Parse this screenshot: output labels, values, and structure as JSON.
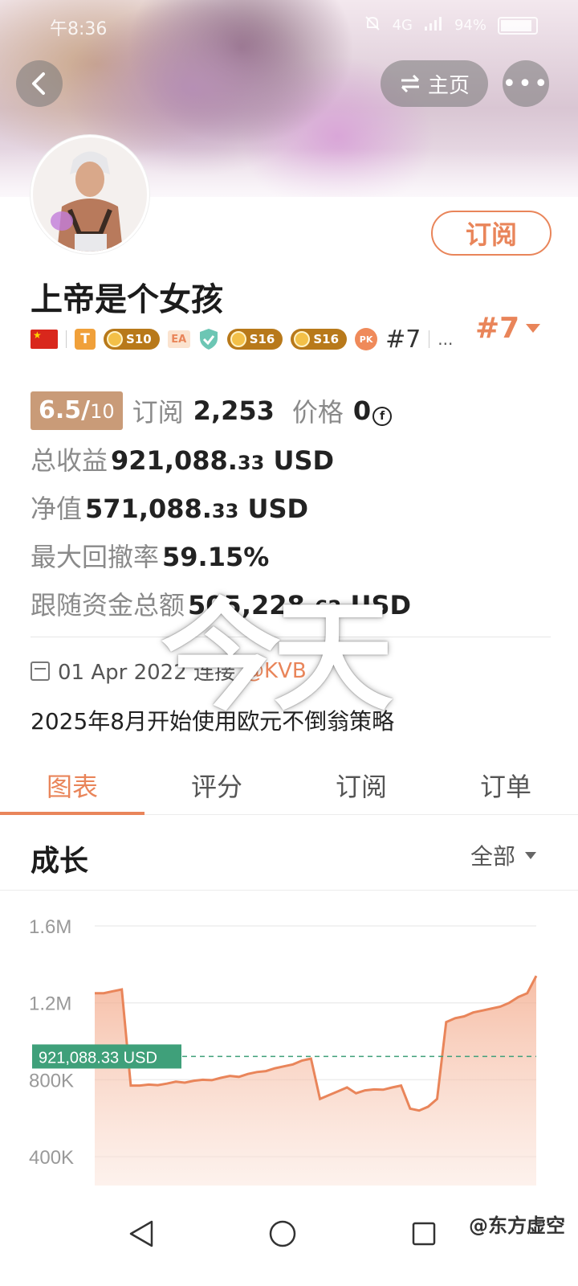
{
  "status_bar": {
    "time": "午8:36",
    "network": "4G",
    "battery": "94%"
  },
  "header": {
    "home_label": "主页"
  },
  "profile": {
    "name": "上帝是个女孩",
    "subscribe_label": "订阅",
    "rank_small": "#7",
    "rank_big": "#7",
    "badges": {
      "t": "T",
      "s10": "S10",
      "ea": "EA",
      "s16a": "S16",
      "s16b": "S16",
      "pk": "PK",
      "more": "..."
    }
  },
  "stats": {
    "score_main": "6.5/",
    "score_total": "10",
    "subs_label": "订阅",
    "subs_value": "2,253",
    "price_label": "价格",
    "price_value": "0",
    "price_coin": "f",
    "total_income_label": "总收益",
    "total_income_main": "921,088.",
    "total_income_cents": "33",
    "total_income_unit": "USD",
    "net_label": "净值",
    "net_main": "571,088.",
    "net_cents": "33",
    "net_unit": "USD",
    "drawdown_label": "最大回撤率",
    "drawdown_value": "59.15%",
    "follow_label": "跟随资金总额",
    "follow_main": "505,228.",
    "follow_cents": "62",
    "follow_unit": "USD"
  },
  "meta": {
    "date": "01 Apr 2022 连接",
    "mention": "@KVB",
    "description": "2025年8月开始使用欧元不倒翁策略"
  },
  "watermark": "今天",
  "tabs": [
    {
      "label": "图表"
    },
    {
      "label": "评分"
    },
    {
      "label": "订阅"
    },
    {
      "label": "订单"
    }
  ],
  "section": {
    "title": "成长",
    "filter": "全部"
  },
  "chart_data": {
    "type": "area",
    "y_ticks": [
      "1.6M",
      "1.2M",
      "800K",
      "400K"
    ],
    "ylim": [
      250000,
      1600000
    ],
    "reference_label": "921,088.33 USD",
    "reference_value": 921088.33,
    "series": [
      {
        "values": [
          1250000,
          1250000,
          1260000,
          1270000,
          770000,
          770000,
          775000,
          772000,
          780000,
          790000,
          785000,
          795000,
          800000,
          798000,
          810000,
          820000,
          815000,
          830000,
          840000,
          845000,
          860000,
          870000,
          880000,
          900000,
          910000,
          700000,
          720000,
          740000,
          760000,
          730000,
          745000,
          750000,
          748000,
          760000,
          770000,
          650000,
          640000,
          660000,
          700000,
          1100000,
          1120000,
          1130000,
          1150000,
          1160000,
          1170000,
          1180000,
          1200000,
          1230000,
          1250000,
          1340000
        ]
      }
    ]
  },
  "nav": {
    "credit": "@东方虚空"
  },
  "colors": {
    "accent": "#e9855a",
    "reference_line": "#3fa07a",
    "score_bg": "#c99b78"
  }
}
